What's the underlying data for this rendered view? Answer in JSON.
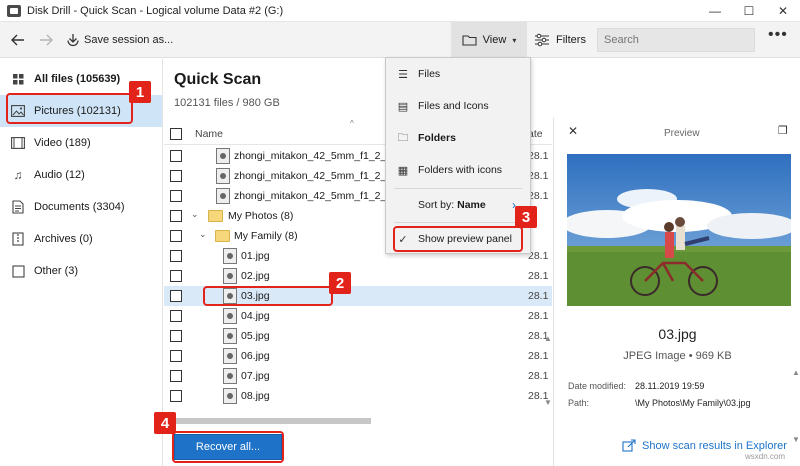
{
  "window": {
    "title": "Disk Drill - Quick Scan - Logical volume Data #2 (G:)",
    "controls": [
      "—",
      "☐",
      "✕"
    ]
  },
  "toolbar": {
    "back_icon": "arrow-left-icon",
    "forward_icon": "arrow-right-icon",
    "save_session_label": "Save session as...",
    "view_label": "View",
    "filters_label": "Filters",
    "search_placeholder": "Search",
    "more_label": "•••"
  },
  "sidebar": {
    "items": [
      {
        "label": "All files (105639)",
        "icon": "all-files-icon",
        "active": false
      },
      {
        "label": "Pictures (102131)",
        "icon": "picture-icon",
        "active": true
      },
      {
        "label": "Video (189)",
        "icon": "video-icon",
        "active": false
      },
      {
        "label": "Audio (12)",
        "icon": "music-note-icon",
        "active": false
      },
      {
        "label": "Documents (3304)",
        "icon": "document-icon",
        "active": false
      },
      {
        "label": "Archives (0)",
        "icon": "archive-icon",
        "active": false
      },
      {
        "label": "Other (3)",
        "icon": "other-icon",
        "active": false
      }
    ]
  },
  "main": {
    "title": "Quick Scan",
    "subtitle": "102131 files / 980 GB",
    "columns": {
      "name": "Name",
      "date": "ate"
    },
    "rows": [
      {
        "name": "zhongi_mitakon_42_5mm_f1_2_28.jpg",
        "date": "28.1",
        "type": "file",
        "indent": 1,
        "selected": false
      },
      {
        "name": "zhongi_mitakon_42_5mm_f1_2_29.jpg",
        "date": "28.1",
        "type": "file",
        "indent": 1,
        "selected": false
      },
      {
        "name": "zhongi_mitakon_42_5mm_f1_2_30.jpg",
        "date": "28.1",
        "type": "file",
        "indent": 1,
        "selected": false
      },
      {
        "name": "My Photos (8)",
        "date": "",
        "type": "folder",
        "indent": 0,
        "selected": false
      },
      {
        "name": "My Family (8)",
        "date": "",
        "type": "folder",
        "indent": 1,
        "selected": false
      },
      {
        "name": "01.jpg",
        "date": "28.1",
        "type": "file",
        "indent": 2,
        "selected": false
      },
      {
        "name": "02.jpg",
        "date": "28.1",
        "type": "file",
        "indent": 2,
        "selected": false
      },
      {
        "name": "03.jpg",
        "date": "28.1",
        "type": "file",
        "indent": 2,
        "selected": true
      },
      {
        "name": "04.jpg",
        "date": "28.1",
        "type": "file",
        "indent": 2,
        "selected": false
      },
      {
        "name": "05.jpg",
        "date": "28.1",
        "type": "file",
        "indent": 2,
        "selected": false
      },
      {
        "name": "06.jpg",
        "date": "28.1",
        "type": "file",
        "indent": 2,
        "selected": false
      },
      {
        "name": "07.jpg",
        "date": "28.1",
        "type": "file",
        "indent": 2,
        "selected": false
      },
      {
        "name": "08.jpg",
        "date": "28.1",
        "type": "file",
        "indent": 2,
        "selected": false
      }
    ],
    "recover_label": "Recover all..."
  },
  "view_menu": {
    "items": [
      {
        "label": "Files",
        "icon": "list-icon"
      },
      {
        "label": "Files and Icons",
        "icon": "list-icons-icon"
      },
      {
        "label": "Folders",
        "icon": "folder-outline-icon"
      },
      {
        "label": "Folders with icons",
        "icon": "folder-icons-icon"
      }
    ],
    "sort_prefix": "Sort by: ",
    "sort_value": "Name",
    "preview_label": "Show preview panel",
    "preview_checked": true
  },
  "preview": {
    "title": "Preview",
    "file_name": "03.jpg",
    "file_type": "JPEG Image • 969 KB",
    "date_modified_label": "Date modified:",
    "date_modified_value": "28.11.2019 19:59",
    "path_label": "Path:",
    "path_value": "\\My Photos\\My Family\\03.jpg"
  },
  "footer": {
    "show_results_label": "Show scan results in Explorer"
  },
  "annotations": [
    "1",
    "2",
    "3",
    "4"
  ],
  "watermark": "wsxdn.com",
  "colors": {
    "accent": "#1e73c9",
    "annotation_red": "#e2231a",
    "selection": "#cfe5f7"
  }
}
